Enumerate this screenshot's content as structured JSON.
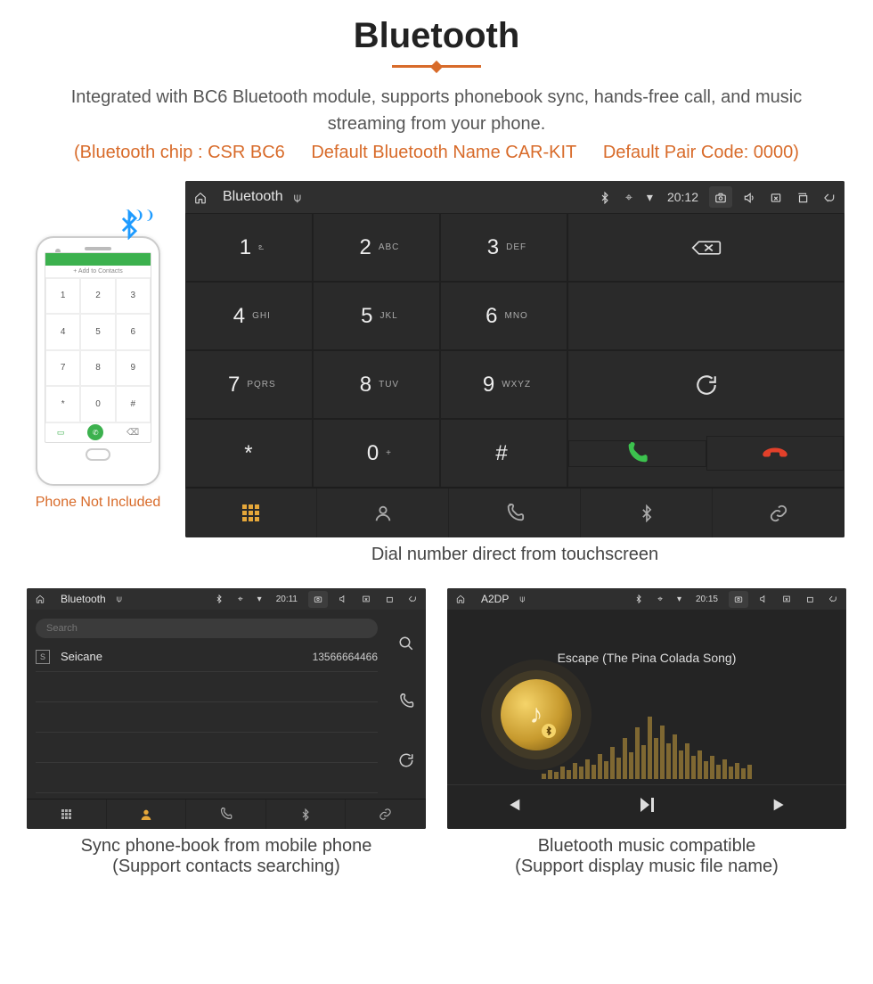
{
  "page": {
    "title": "Bluetooth",
    "intro": "Integrated with BC6 Bluetooth module, supports phonebook sync, hands-free call, and music streaming from your phone.",
    "spec_chip": "(Bluetooth chip : CSR BC6",
    "spec_name": "Default Bluetooth Name CAR-KIT",
    "spec_code": "Default Pair Code: 0000)"
  },
  "phone_mock": {
    "add_label": "+  Add to Contacts",
    "keys": [
      "1",
      "2",
      "3",
      "4",
      "5",
      "6",
      "7",
      "8",
      "9",
      "*",
      "0",
      "#"
    ],
    "caption": "Phone Not Included"
  },
  "dialer": {
    "status": {
      "title": "Bluetooth",
      "time": "20:12"
    },
    "keys": [
      {
        "main": "1",
        "sub": "ఽ"
      },
      {
        "main": "2",
        "sub": "ABC"
      },
      {
        "main": "3",
        "sub": "DEF"
      },
      {
        "main": "4",
        "sub": "GHI"
      },
      {
        "main": "5",
        "sub": "JKL"
      },
      {
        "main": "6",
        "sub": "MNO"
      },
      {
        "main": "7",
        "sub": "PQRS"
      },
      {
        "main": "8",
        "sub": "TUV"
      },
      {
        "main": "9",
        "sub": "WXYZ"
      },
      {
        "main": "*",
        "sub": ""
      },
      {
        "main": "0",
        "sub": "+"
      },
      {
        "main": "#",
        "sub": ""
      }
    ],
    "caption": "Dial number direct from touchscreen"
  },
  "contacts": {
    "status": {
      "title": "Bluetooth",
      "time": "20:11"
    },
    "search_placeholder": "Search",
    "rows": [
      {
        "initial": "S",
        "name": "Seicane",
        "number": "13566664466"
      }
    ],
    "caption_line1": "Sync phone-book from mobile phone",
    "caption_line2": "(Support contacts searching)"
  },
  "music": {
    "status": {
      "title": "A2DP",
      "time": "20:15"
    },
    "song": "Escape (The Pina Colada Song)",
    "viz_heights": [
      6,
      10,
      8,
      14,
      10,
      18,
      14,
      22,
      16,
      28,
      20,
      36,
      24,
      46,
      30,
      58,
      38,
      70,
      46,
      60,
      40,
      50,
      32,
      40,
      26,
      32,
      20,
      26,
      16,
      22,
      14,
      18,
      12,
      16
    ],
    "caption_line1": "Bluetooth music compatible",
    "caption_line2": "(Support display music file name)"
  }
}
